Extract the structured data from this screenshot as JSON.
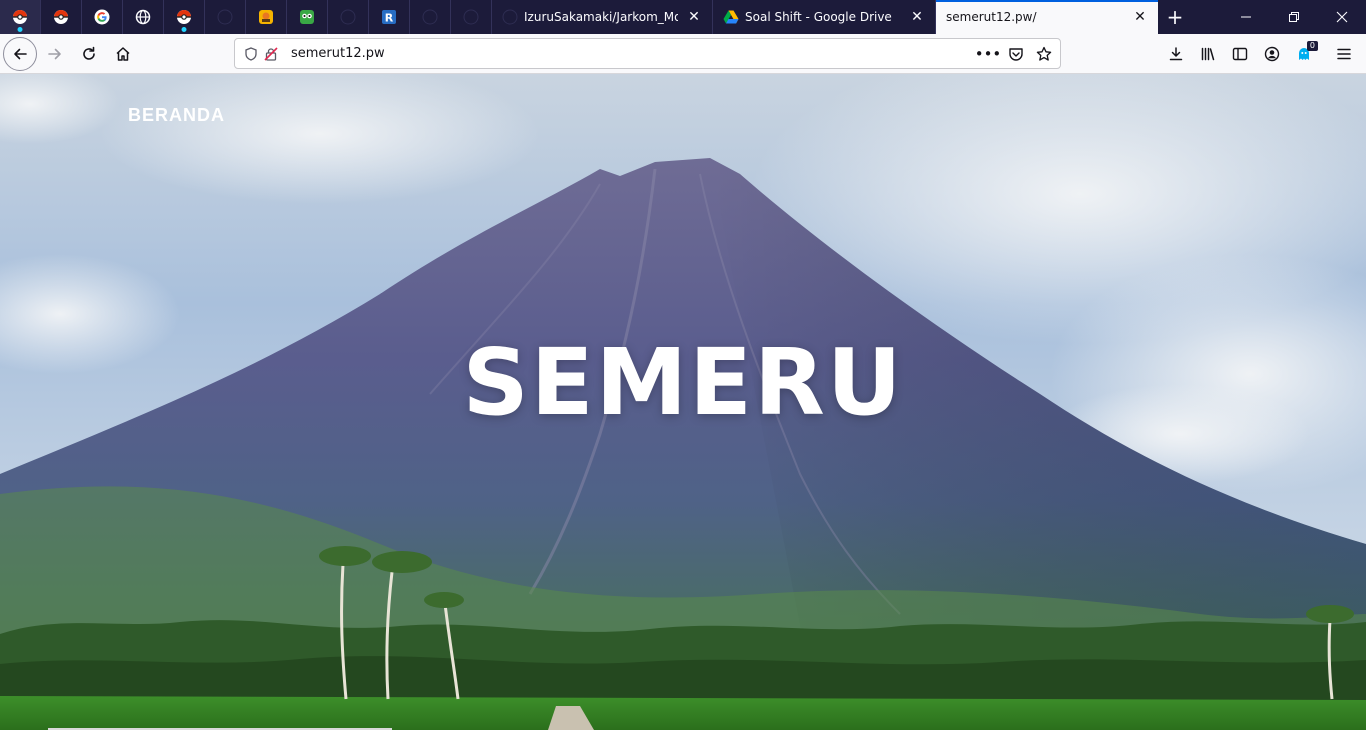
{
  "browser": {
    "pinned_tabs": [
      {
        "icon": "pokeball-icon",
        "color": "#e3350d"
      },
      {
        "icon": "pokeball-icon",
        "color": "#e3350d"
      },
      {
        "icon": "google-icon",
        "color": "#4285f4"
      },
      {
        "icon": "globe-icon",
        "color": "#fbfbfe"
      },
      {
        "icon": "pokeball-icon",
        "color": "#e3350d"
      },
      {
        "icon": "github-icon",
        "color": "#33325a"
      },
      {
        "icon": "app-icon",
        "color": "#f5b400"
      },
      {
        "icon": "owl-icon",
        "color": "#39a845"
      },
      {
        "icon": "github-icon",
        "color": "#33325a"
      },
      {
        "icon": "r-icon",
        "color": "#276dc3"
      },
      {
        "icon": "github-icon",
        "color": "#33325a"
      },
      {
        "icon": "github-icon",
        "color": "#33325a"
      }
    ],
    "tabs": [
      {
        "title": "IzuruSakamaki/Jarkom_Modul",
        "icon": "github-icon"
      },
      {
        "title": "Soal Shift - Google Drive",
        "icon": "google-drive-icon"
      },
      {
        "title": "semerut12.pw/",
        "icon": "none",
        "active": true
      }
    ],
    "new_tab_label": "+",
    "url": "semerut12.pw",
    "notification_count": "0"
  },
  "page": {
    "nav_link": "BERANDA",
    "hero_title": "SEMERU"
  }
}
